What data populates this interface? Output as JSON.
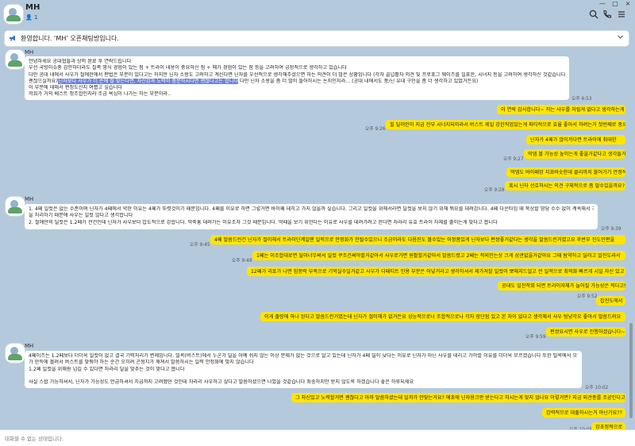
{
  "header": {
    "title": "MH",
    "member_count": "1",
    "person_glyph": "👤",
    "icons": [
      "search-icon",
      "phone-icon",
      "menu-icon"
    ],
    "window_controls": [
      "—",
      "□",
      "×"
    ]
  },
  "notice": {
    "text": "환영합니다. ‘MH’ 오픈채팅방입니다.",
    "icon": "megaphone-icon"
  },
  "messages": {
    "m1": {
      "sender": "MH",
      "lines": [
        "안녕하세요 공대협들과 상의 완료 후 연락드립니다",
        "우선 국방이슈중 감안하더라도 칠족 영식 경험이 있는 점 + 트라이 내용이 중요하신 점 + 메가 경험이 있는 점 등을 고려하여 긍정적으로 생각하고 있습니다",
        "다만 공대 내에서 사우가 절에한에서 편법은 부분이 있다고는 하지만 닌자 소왕도 고려하고 계신다면 닌자를 우선적으로 생각해주셨으면 하는 의견이 더 많은 상황입니다 (각자 골넙활자 의견 및 프로포그 웨이즈를 일표한, 시녀지 등을 고려하여 생각하신 것같습니다) 혹시 이 부분이"
      ],
      "line4_before": "괜찮으실까요?",
      "line4_highlight": "닌자보다 사우가 더 손에 잘 맞는다면, 자신감과 노력이 충분하시다면 괜찮다고는 합니다",
      "line4_after": " 다만 닌자 소왕을 좀 더 많이 들어하시는 논지인지라... (공대 내에서도 풍/닌 유대 구인을 좀 더 생각하고 있었거든요)",
      "lines_after": [
        "이 부분에 대해서 편정도신지 여쭙고 싶습니다",
        "저희가 거의 베스트 정조합인지라 조금 욕심이 나가는 하는 부분이라.."
      ],
      "time": "오후 6:53"
    },
    "out1": [
      {
        "text": "아 연락 감사합니다~ 저는 사우를 처릴게 없다고 생각하는게",
        "time": ""
      },
      {
        "text": "힐 딜러인이 지금 전부 시너지되미라서 버스트 제일 강한직업있는게 파티적으로 효율 좋아서 하려는거 첫번째로 중요구요",
        "time": "오후 9:26"
      },
      {
        "text": "닌자가 4페가 많이까다면 트라이에 최대한",
        "time": ""
      },
      {
        "text": "딱뎀 볼 가능성 높이는게 좋을거같다고 생각들거든요",
        "time": "오후 9:27"
      },
      {
        "text": "딱뎀도 바이패망 지표바숫한데 클리까지 불어가기 안정적일거 같은데",
        "time": ""
      },
      {
        "text": "혹시 닌자 선호하시는 의견 구체적으로 좀 말수있을까요?",
        "time": "오후 9:28"
      }
    ],
    "m2": {
      "sender": "MH",
      "lines": [
        "1. 4페 일컷은 없는 수준이며 닌자가 4페에서 약한 이유는 4페가 뚜렷것이기 때문입니다. 4페를 이유로 하면 그렇거면 바이패 데히고 가지 않을까 싶습니다. 그리고 일컷을 위해서라면 딜컷을 보지 않기 위해 뭐요를 데려갑니다. 4페 다운타임 때 묵상할 땅당 수수 없이 계속해서 기럭",
        "을 처리하기 때문에 사우는 일컷 않다고 생각합니다",
        "2. 절에만의 딜컷은 1.2페가 관건인데 닌자가 사우보다 압도적으로 강합니다. 딱죽홍 데려가는 이유조차 그것 때문입니다. 딱때을 보기 위한다는 이유로 사우를 데려가려고 한다면 차라리 유효 트라이 자체를 줄이는게 맞다고 봅니다"
      ],
      "time": "오후 9:39"
    },
    "out2": [
      {
        "text": "4페 말씀드린건 닌자가 절이해서 트라이단계일땐 일적으로 안정화가 안될수있으니 조금이라도 다음진도 볼수있는 이정쫌있게 닌자보다 편쌍좋거같다는 생각을 말씀드린거였고요 후반부 진도인편을",
        "time": "오후 9:45"
      },
      {
        "text": "1페는 이조합대로면 딜이너무써서 일컷 쿠조건써야할거같아서 사우로가면 원활할거같아서 말씀드렸고 2페는 적외인는상 크게 상관없을거같아요 그때 탐약하고 딜러고 알진도라서",
        "time": "오후 9:48"
      },
      {
        "text": "12페가 리포가 나면 힘쫑력 부족으로 기억실수일거같고 사우가 디패티트 인용 부분은 어넣거라고 생각하셔서 제가져할 일컷이 뽀해지드얼고 전 일적으로 최적화 빠르게 시일 자신 있고",
        "time": ""
      },
      {
        "text": "공대도 일진착화 되면 트라이자체가 늘어질 가능성은 적다고봐요",
        "time": "오후 9:52"
      },
      {
        "text": "잡진도에서",
        "time": ""
      },
      {
        "text": "이게 출랑에 하나 된다고 말씀드린거였는데 닌자가 절이해가 없거든요 성능적으로나 조합적으로나 각자 장단점 있고 본 차이 없다고 생각해서 사우 탕냥각오 좋아서 말씀드려요",
        "time": ""
      },
      {
        "text": "편쌍요시면 사우로 진행하겠습니다~",
        "time": "오후 9:59"
      }
    ],
    "m3": {
      "sender": "MH",
      "lines": [
        "4페이즈는 1.2페보다 더더욱 일컷이 없고 결국 기력처리가 변제입니다. 빌록(버스트)에서 누군가 딜을 아예 쉬지 않는 이상 문제가 없는 것으로 알고 있는데 닌자가 4페 딜이 낮다는 이유로 닌자가 아닌 사우를 데리고 가야할 이유를 더더욱 모르겠습니다 또한 빌록에서 오히려 사우라기",
        "가 한특에 몰려서 버스트를 맞춰야 하는 순간 오히려 곤형치가 깨져서 말씀하시는 일적 안정화에 맞지 않습니다",
        "1.2페 일컷을 위해원 넘길 수 있다면 차라리 딜을 맞추는 것이 맞다고 봅니다",
        "",
        "사실 스왑 가능하셔서, 닌자가 가능성도 언급하셔서 치급까지 고려했던 것인데 차라리 사우하고 싶다고 말씀하셨으면 나았을 것같습니다 죄송하지만 받지 않도록 하겠습니다 좋은 하루되세요"
      ],
      "time": "오후 10:02"
    },
    "out3": [
      {
        "text": "그 자신있고 노력할거면 괜찮다고 아까 말씀하셨는데 일까가 안맞는거요? 애초에 닌자용크판 받는다고 하시는게 맞지 않나요 이렇거면? 지금 외견총를 조공인다고",
        "time": ""
      },
      {
        "text": "감력적으로 대출하시는거 아닌가요??",
        "time": ""
      },
      {
        "text": "강초정적으로",
        "time": "오후 10:05"
      }
    ]
  },
  "input": {
    "placeholder": "대화할 수 없는 상태입니다."
  },
  "colors": {
    "background": "#b5c9dc",
    "my_bubble": "#fee500",
    "their_bubble": "#ffffff",
    "highlight": "#6b83d9"
  }
}
